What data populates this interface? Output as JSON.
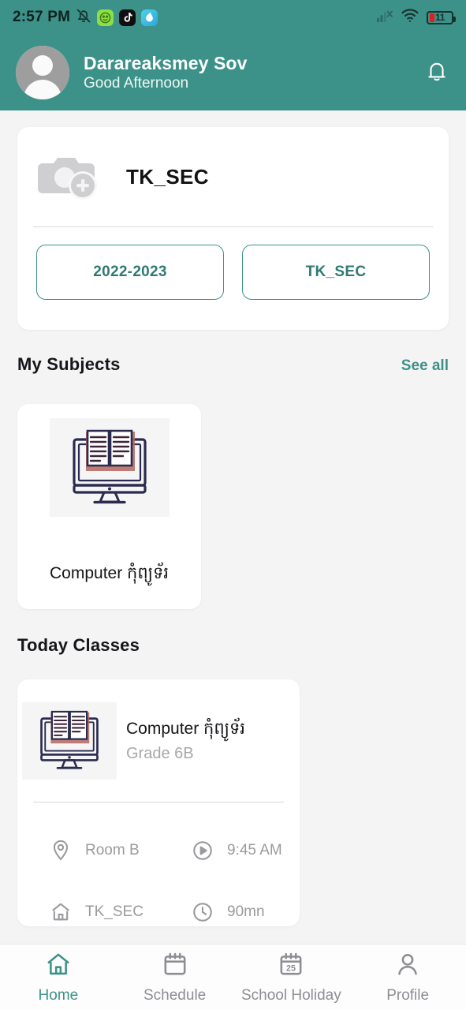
{
  "statusbar": {
    "time": "2:57 PM",
    "icons": [
      "bell-slash-icon",
      "green-app-icon",
      "tiktok-app-icon",
      "blue-app-icon"
    ],
    "signal": "signal-off-icon",
    "wifi": "wifi-icon",
    "battery_level": "11"
  },
  "header": {
    "avatar": "user-avatar",
    "name": "Darareaksmey Sov",
    "greeting": "Good Afternoon",
    "bell": "notification-bell-icon"
  },
  "school_card": {
    "photo_placeholder": "add-photo-icon",
    "title": "TK_SEC",
    "chips": [
      {
        "label": "2022-2023"
      },
      {
        "label": "TK_SEC"
      }
    ]
  },
  "my_subjects": {
    "title": "My Subjects",
    "see_all": "See all",
    "items": [
      {
        "name": "Computer កុំព្យូទ័រ",
        "icon": "computer-book-icon"
      }
    ]
  },
  "today_classes": {
    "title": "Today Classes",
    "items": [
      {
        "name": "Computer កុំព្យូទ័រ",
        "grade": "Grade 6B",
        "icon": "computer-book-icon",
        "details": [
          {
            "icon": "location-pin-icon",
            "value": "Room B"
          },
          {
            "icon": "play-circle-icon",
            "value": "9:45 AM"
          },
          {
            "icon": "home-icon",
            "value": "TK_SEC"
          },
          {
            "icon": "clock-icon",
            "value": "90mn"
          }
        ]
      }
    ]
  },
  "bottom_nav": {
    "active": "Home",
    "items": [
      {
        "label": "Home",
        "icon": "home-icon"
      },
      {
        "label": "Schedule",
        "icon": "calendar-icon"
      },
      {
        "label": "School Holiday",
        "icon": "calendar-25-icon"
      },
      {
        "label": "Profile",
        "icon": "person-icon"
      }
    ]
  },
  "colors": {
    "accent": "#3c9288",
    "background": "#f4f4f5",
    "card": "#ffffff",
    "muted_text": "#9a9a9f",
    "battery_red": "#e02020",
    "icon_navy": "#2b2b4f",
    "icon_red": "#a85c55"
  }
}
